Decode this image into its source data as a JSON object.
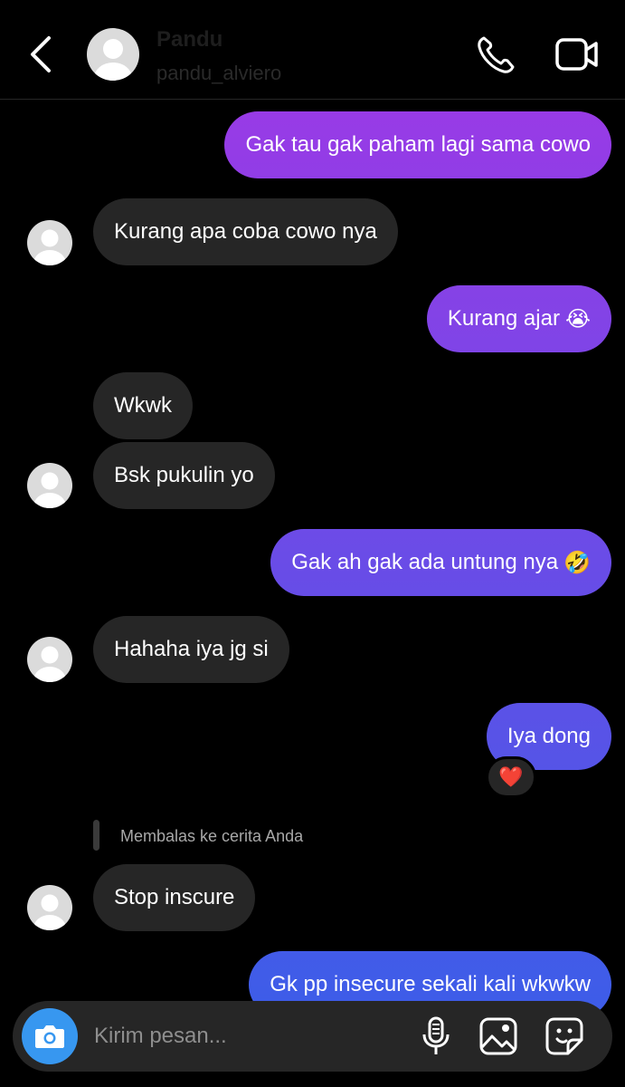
{
  "header": {
    "contact_name": "Pandu",
    "username": "pandu_alviero"
  },
  "messages": [
    {
      "dir": "out",
      "text": "Gak tau gak paham lagi sama cowo"
    },
    {
      "dir": "in",
      "text": "Kurang apa coba cowo nya"
    },
    {
      "dir": "out",
      "text": "Kurang ajar",
      "emoji": "😭"
    },
    {
      "dir": "in",
      "text": "Wkwk"
    },
    {
      "dir": "in",
      "text": "Bsk pukulin yo"
    },
    {
      "dir": "out",
      "text": "Gak ah gak ada untung nya",
      "emoji": "🤣"
    },
    {
      "dir": "in",
      "text": "Hahaha iya jg si"
    },
    {
      "dir": "out",
      "text": "Iya dong",
      "reaction": "❤️"
    },
    {
      "dir": "in",
      "text": "Stop inscure",
      "reply_label": "Membalas ke cerita Anda"
    },
    {
      "dir": "out",
      "text": "Gk pp insecure sekali kali wkwkw"
    }
  ],
  "composer": {
    "placeholder": "Kirim pesan..."
  },
  "icons": {
    "back": "chevron-left-icon",
    "call": "phone-icon",
    "video": "video-camera-icon",
    "camera": "camera-icon",
    "mic": "microphone-icon",
    "gallery": "image-icon",
    "sticker": "sticker-icon"
  },
  "colors": {
    "background": "#000000",
    "incoming_bubble": "#262626",
    "outgoing_gradient_top": "#9a3ae6",
    "outgoing_gradient_bottom": "#3d5de8",
    "camera_button": "#3797f0"
  }
}
